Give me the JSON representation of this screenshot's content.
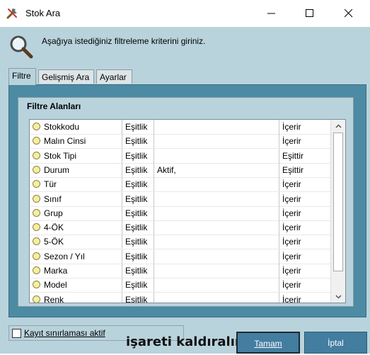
{
  "window": {
    "title": "Stok Ara",
    "icon": "tools-icon"
  },
  "hint": {
    "text": "Aşağıya istediğiniz filtreleme kriterini giriniz.",
    "icon": "magnifier-icon"
  },
  "tabs": [
    {
      "label": "Filtre",
      "active": true
    },
    {
      "label": "Gelişmiş Ara",
      "active": false
    },
    {
      "label": "Ayarlar",
      "active": false
    }
  ],
  "group": {
    "title": "Filtre Alanları"
  },
  "rows": [
    {
      "field": "Stokkodu",
      "op": "Eşitlik",
      "value": "",
      "mode": "İçerir"
    },
    {
      "field": "Malın Cinsi",
      "op": "Eşitlik",
      "value": "",
      "mode": "İçerir"
    },
    {
      "field": "Stok Tipi",
      "op": "Eşitlik",
      "value": "",
      "mode": "Eşittir"
    },
    {
      "field": "Durum",
      "op": "Eşitlik",
      "value": "Aktif,",
      "mode": "Eşittir"
    },
    {
      "field": "Tür",
      "op": "Eşitlik",
      "value": "",
      "mode": "İçerir"
    },
    {
      "field": "Sınıf",
      "op": "Eşitlik",
      "value": "",
      "mode": "İçerir"
    },
    {
      "field": "Grup",
      "op": "Eşitlik",
      "value": "",
      "mode": "İçerir"
    },
    {
      "field": "4-ÖK",
      "op": "Eşitlik",
      "value": "",
      "mode": "İçerir"
    },
    {
      "field": "5-ÖK",
      "op": "Eşitlik",
      "value": "",
      "mode": "İçerir"
    },
    {
      "field": "Sezon / Yıl",
      "op": "Eşitlik",
      "value": "",
      "mode": "İçerir"
    },
    {
      "field": "Marka",
      "op": "Eşitlik",
      "value": "",
      "mode": "İçerir"
    },
    {
      "field": "Model",
      "op": "Eşitlik",
      "value": "",
      "mode": "İçerir"
    },
    {
      "field": "Renk",
      "op": "Eşitlik",
      "value": "",
      "mode": "İçerir"
    }
  ],
  "footer": {
    "checkbox_label": "Kayıt sınırlaması aktif",
    "checkbox_checked": false,
    "overlay_text": "işareti kaldıralım",
    "ok_label": "Tamam",
    "cancel_label": "İptal"
  },
  "colors": {
    "panel": "#b9d3dc",
    "tab_panel": "#4d8aa3",
    "button": "#437da0"
  }
}
